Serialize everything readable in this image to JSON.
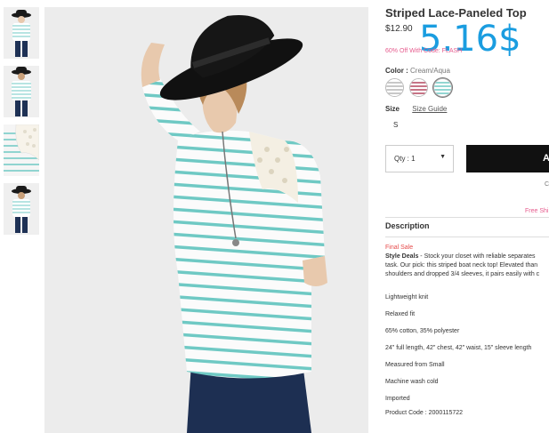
{
  "product": {
    "title": "Striped Lace-Paneled Top",
    "price": "$12.90",
    "overlay_price": "5.16$",
    "promo": "60% Off With Code: FLASH"
  },
  "color": {
    "label": "Color :",
    "value": "Cream/Aqua",
    "swatches": [
      {
        "name": "cream-grey",
        "colors": [
          "#ffffff",
          "#b5b5b5"
        ]
      },
      {
        "name": "cream-red",
        "colors": [
          "#ffffff",
          "#b4475e"
        ]
      },
      {
        "name": "cream-aqua",
        "colors": [
          "#ffffff",
          "#6fc9c4"
        ],
        "selected": true
      }
    ]
  },
  "size": {
    "label": "Size",
    "guide": "Size Guide",
    "value": "S"
  },
  "purchase": {
    "qty": "Qty : 1",
    "add_label": "A",
    "edge_text": "C",
    "free_ship": "Free Shi"
  },
  "description": {
    "heading": "Description",
    "final_sale": "Final Sale",
    "style_deals_label": "Style Deals",
    "intro_1": " - Stock your closet with reliable separates",
    "intro_2": "task. Our pick: this striped boat neck top! Elevated than",
    "intro_3": "shoulders and dropped 3/4 sleeves, it pairs easily with c",
    "bullets": [
      "Lightweight knit",
      "Relaxed fit",
      "65% cotton, 35% polyester",
      "24\" full length, 42\" chest, 42\" waist, 15\" sleeve length",
      "Measured from Small",
      "Machine wash cold",
      "Imported",
      "Product Code : 2000115722"
    ]
  },
  "colors": {
    "accent_blue": "#1a9de0",
    "promo_pink": "#e65c8e",
    "final_sale_red": "#e64a4a",
    "stripe_aqua": "#6fc9c4",
    "button_black": "#111111"
  }
}
